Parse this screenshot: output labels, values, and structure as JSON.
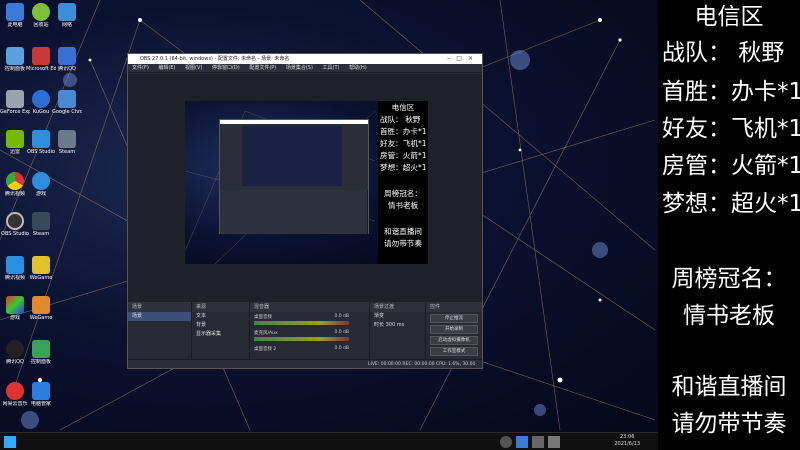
{
  "overlay": {
    "lines": [
      "电信区",
      "战队：  秋野",
      "首胜：办卡*1",
      "好友：飞机*1",
      "房管：火箭*1",
      "梦想：超火*1",
      "周榜冠名：",
      "情书老板",
      "和谐直播间",
      "请勿带节奏"
    ]
  },
  "obs": {
    "title": "OBS 27.0.1 (64-bit, windows) - 配置文件: 未命名 - 场景: 未命名",
    "menu": [
      "文件(F)",
      "编辑(E)",
      "视图(V)",
      "停靠窗口(D)",
      "配置文件(P)",
      "场景集合(S)",
      "工具(T)",
      "帮助(H)"
    ],
    "docks": {
      "scenes": {
        "header": "场景",
        "items": [
          "场景"
        ]
      },
      "sources": {
        "header": "来源",
        "items": [
          "文本",
          "背景",
          "显示器采集"
        ]
      },
      "mixer": {
        "header": "混音器",
        "channels": [
          {
            "name": "桌面音频",
            "value": "0.0 dB"
          },
          {
            "name": "麦克风/Aux",
            "value": "0.0 dB"
          },
          {
            "name": "桌面音频 2",
            "value": "0.0 dB"
          }
        ]
      },
      "transitions": {
        "header": "场景过渡",
        "type": "渐变",
        "duration_label": "时长",
        "duration": "300 ms"
      },
      "controls": {
        "header": "控件",
        "buttons": [
          "停止推流",
          "开始录制",
          "启动虚拟摄像机",
          "工作室模式",
          "设置",
          "退出"
        ]
      }
    },
    "status": "LIVE: 00:00:00   REC: 00:00:00   CPU: 1.6%, 30.00 fps"
  },
  "taskbar": {
    "time": "23:06",
    "date": "2021/6/13"
  },
  "desktop_icons": [
    "此电脑",
    "回收站",
    "网络",
    "控制面板",
    "Microsoft Edge",
    "腾讯QQ",
    "GeForce Experience",
    "KuGou",
    "Google Chrome",
    "迅雷",
    "OBS Studio",
    "Steam",
    "腾讯视频",
    "游戏",
    "WeGame",
    "网易云音乐",
    "电脑管家"
  ]
}
